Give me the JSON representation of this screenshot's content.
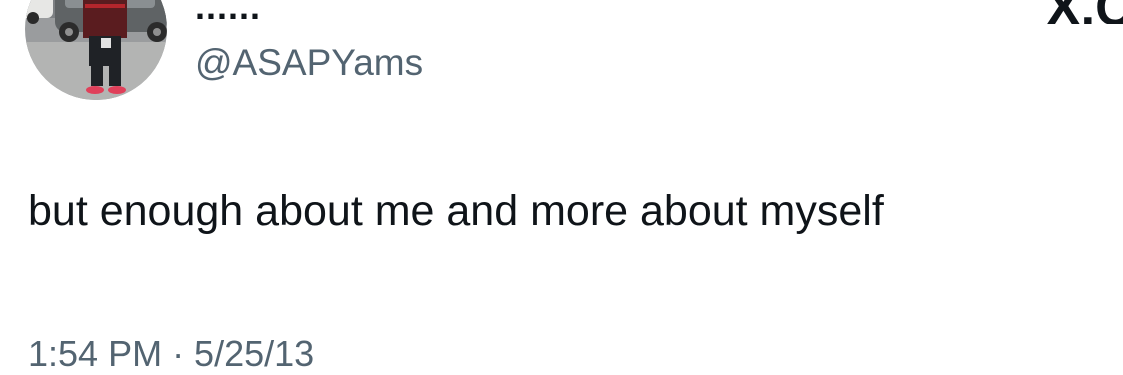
{
  "author": {
    "display_name": "......",
    "handle": "@ASAPYams"
  },
  "brand": {
    "logo_text": "X.C"
  },
  "tweet": {
    "text": "but enough about me and more about myself",
    "timestamp": "1:54 PM · 5/25/13"
  },
  "colors": {
    "text_primary": "#0f1419",
    "text_secondary": "#536471",
    "background": "#ffffff"
  }
}
